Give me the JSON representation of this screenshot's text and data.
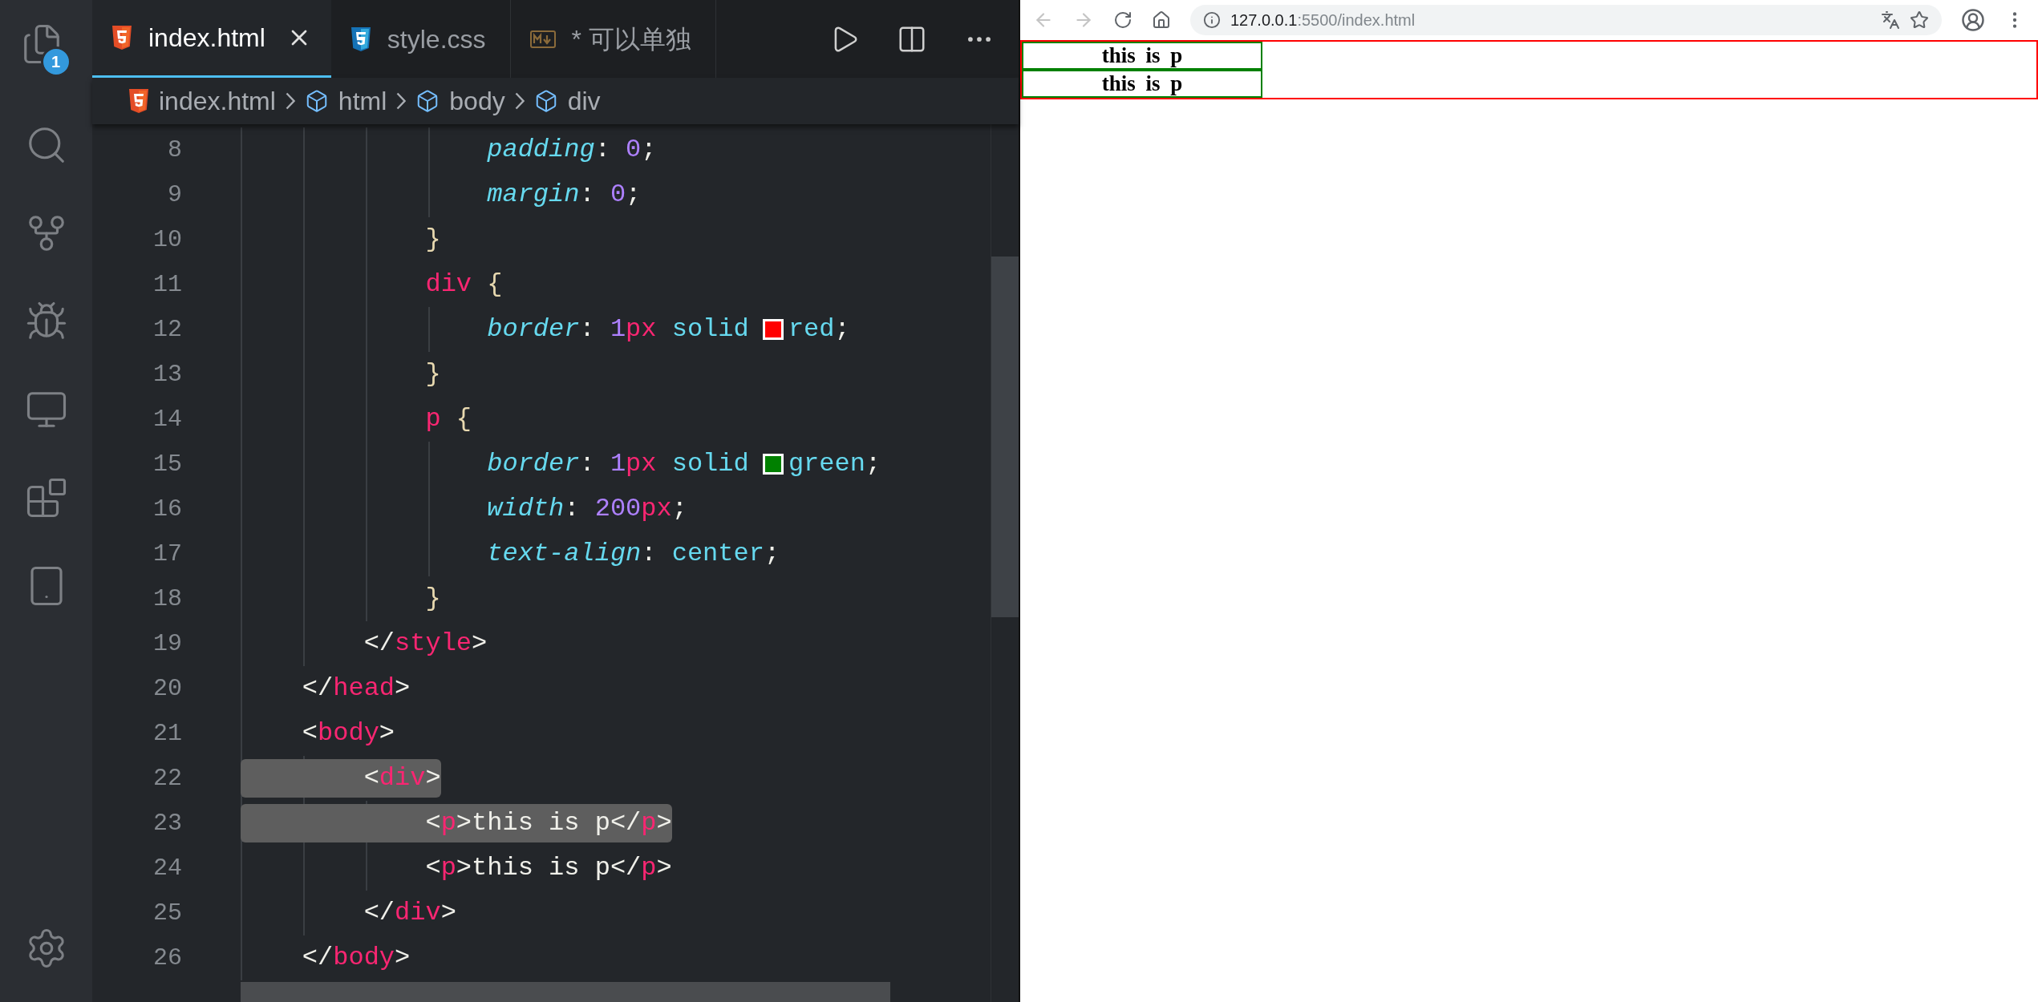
{
  "activity_bar": {
    "explorer_badge": "1"
  },
  "tabs": [
    {
      "label": "index.html",
      "kind": "html",
      "selected": true,
      "closable": true
    },
    {
      "label": "style.css",
      "kind": "css",
      "selected": false,
      "closable": false
    },
    {
      "label": "* 可以单独",
      "kind": "markdown",
      "selected": false,
      "closable": false
    }
  ],
  "breadcrumb": [
    {
      "label": "index.html",
      "kind": "file"
    },
    {
      "label": "html",
      "kind": "element"
    },
    {
      "label": "body",
      "kind": "element"
    },
    {
      "label": "div",
      "kind": "element"
    }
  ],
  "editor": {
    "lines": [
      {
        "number": "8",
        "highlighted": false,
        "tokens": [
          {
            "t": "                padding",
            "kind": "prop"
          },
          {
            "t": ": ",
            "kind": "punct"
          },
          {
            "t": "0",
            "kind": "num"
          },
          {
            "t": ";",
            "kind": "punct"
          }
        ]
      },
      {
        "number": "9",
        "highlighted": false,
        "tokens": [
          {
            "t": "                margin",
            "kind": "prop"
          },
          {
            "t": ": ",
            "kind": "punct"
          },
          {
            "t": "0",
            "kind": "num"
          },
          {
            "t": ";",
            "kind": "punct"
          }
        ]
      },
      {
        "number": "10",
        "highlighted": false,
        "tokens": [
          {
            "t": "            }",
            "kind": "brace"
          }
        ]
      },
      {
        "number": "11",
        "highlighted": false,
        "tokens": [
          {
            "t": "            div",
            "kind": "tag"
          },
          {
            "t": " {",
            "kind": "brace"
          }
        ]
      },
      {
        "number": "12",
        "highlighted": false,
        "tokens": [
          {
            "t": "                border",
            "kind": "prop"
          },
          {
            "t": ": ",
            "kind": "punct"
          },
          {
            "t": "1",
            "kind": "num"
          },
          {
            "t": "px",
            "kind": "unit"
          },
          {
            "t": " solid ",
            "kind": "value"
          },
          {
            "kind": "swatch",
            "color": "#ff0000"
          },
          {
            "t": "red",
            "kind": "value"
          },
          {
            "t": ";",
            "kind": "punct"
          }
        ]
      },
      {
        "number": "13",
        "highlighted": false,
        "tokens": [
          {
            "t": "            }",
            "kind": "brace"
          }
        ]
      },
      {
        "number": "14",
        "highlighted": false,
        "tokens": [
          {
            "t": "            p",
            "kind": "tag"
          },
          {
            "t": " {",
            "kind": "brace"
          }
        ]
      },
      {
        "number": "15",
        "highlighted": false,
        "tokens": [
          {
            "t": "                border",
            "kind": "prop"
          },
          {
            "t": ": ",
            "kind": "punct"
          },
          {
            "t": "1",
            "kind": "num"
          },
          {
            "t": "px",
            "kind": "unit"
          },
          {
            "t": " solid ",
            "kind": "value"
          },
          {
            "kind": "swatch",
            "color": "#008000"
          },
          {
            "t": "green",
            "kind": "value"
          },
          {
            "t": ";",
            "kind": "punct"
          }
        ]
      },
      {
        "number": "16",
        "highlighted": false,
        "tokens": [
          {
            "t": "                width",
            "kind": "prop"
          },
          {
            "t": ": ",
            "kind": "punct"
          },
          {
            "t": "200",
            "kind": "num"
          },
          {
            "t": "px",
            "kind": "unit"
          },
          {
            "t": ";",
            "kind": "punct"
          }
        ]
      },
      {
        "number": "17",
        "highlighted": false,
        "tokens": [
          {
            "t": "                text-align",
            "kind": "prop"
          },
          {
            "t": ": ",
            "kind": "punct"
          },
          {
            "t": "center",
            "kind": "value"
          },
          {
            "t": ";",
            "kind": "punct"
          }
        ]
      },
      {
        "number": "18",
        "highlighted": false,
        "tokens": [
          {
            "t": "            }",
            "kind": "brace"
          }
        ]
      },
      {
        "number": "19",
        "highlighted": false,
        "tokens": [
          {
            "t": "        </",
            "kind": "punct"
          },
          {
            "t": "style",
            "kind": "tag"
          },
          {
            "t": ">",
            "kind": "punct"
          }
        ]
      },
      {
        "number": "20",
        "highlighted": false,
        "tokens": [
          {
            "t": "    </",
            "kind": "punct"
          },
          {
            "t": "head",
            "kind": "tag"
          },
          {
            "t": ">",
            "kind": "punct"
          }
        ]
      },
      {
        "number": "21",
        "highlighted": false,
        "tokens": [
          {
            "t": "    <",
            "kind": "punct"
          },
          {
            "t": "body",
            "kind": "tag"
          },
          {
            "t": ">",
            "kind": "punct"
          }
        ]
      },
      {
        "number": "22",
        "highlighted": true,
        "tokens": [
          {
            "t": "        <",
            "kind": "punct"
          },
          {
            "t": "div",
            "kind": "tag"
          },
          {
            "t": ">",
            "kind": "punct"
          }
        ]
      },
      {
        "number": "23",
        "highlighted": true,
        "tokens": [
          {
            "t": "            <",
            "kind": "punct"
          },
          {
            "t": "p",
            "kind": "tag"
          },
          {
            "t": ">this is p</",
            "kind": "punct"
          },
          {
            "t": "p",
            "kind": "tag"
          },
          {
            "t": ">",
            "kind": "punct"
          }
        ]
      },
      {
        "number": "24",
        "highlighted": false,
        "tokens": [
          {
            "t": "            <",
            "kind": "punct"
          },
          {
            "t": "p",
            "kind": "tag"
          },
          {
            "t": ">this is p</",
            "kind": "punct"
          },
          {
            "t": "p",
            "kind": "tag"
          },
          {
            "t": ">",
            "kind": "punct"
          }
        ]
      },
      {
        "number": "25",
        "highlighted": false,
        "tokens": [
          {
            "t": "        </",
            "kind": "punct"
          },
          {
            "t": "div",
            "kind": "tag"
          },
          {
            "t": ">",
            "kind": "punct"
          }
        ]
      },
      {
        "number": "26",
        "highlighted": false,
        "tokens": [
          {
            "t": "    </",
            "kind": "punct"
          },
          {
            "t": "body",
            "kind": "tag"
          },
          {
            "t": ">",
            "kind": "punct"
          }
        ]
      }
    ]
  },
  "browser": {
    "url_host": "127.0.0.1",
    "url_path": ":5500/index.html",
    "paragraphs": [
      "this is p",
      "this is p"
    ]
  }
}
